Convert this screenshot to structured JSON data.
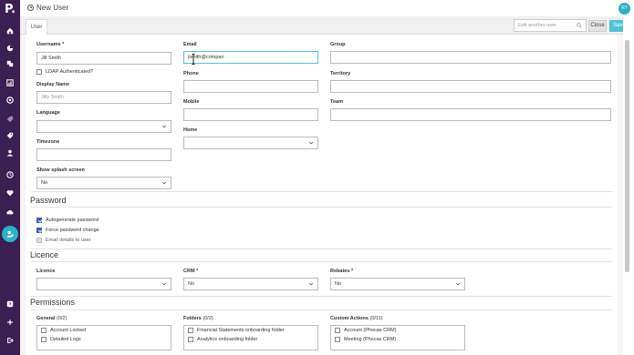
{
  "app": {
    "logo_letter": "P."
  },
  "header": {
    "title": "New User",
    "avatar_initials": "RT"
  },
  "colors": {
    "sidebar_bg": "#3a1f52",
    "accent": "#2bb3c7",
    "save_bg": "#4dc3d6",
    "checkbox_on": "#3a5fb5"
  },
  "sidebar": {
    "icons": [
      "home-icon",
      "chart-icon",
      "layers-icon",
      "report-icon",
      "analytics-icon",
      "tag-icon",
      "tag-alt-icon",
      "person-icon",
      "history-icon",
      "heart-icon",
      "cloud-icon",
      "user-settings-icon",
      "help-icon",
      "add-icon",
      "logout-icon"
    ],
    "active_icon": "user-settings-icon"
  },
  "tabs": [
    {
      "label": "User"
    }
  ],
  "toolbar": {
    "edit_another_placeholder": "Edit another user",
    "close_label": "Close",
    "save_label": "Save"
  },
  "form": {
    "username": {
      "label": "Username",
      "value": "Jill Smith"
    },
    "ldap": {
      "label": "LDAP Authenticated?",
      "checked": false
    },
    "display_name": {
      "label": "Display Name",
      "placeholder": "Jilly Smith"
    },
    "language": {
      "label": "Language",
      "value": ""
    },
    "timezone": {
      "label": "Timezone",
      "value": ""
    },
    "splash": {
      "label": "Show splash screen",
      "value": "No"
    },
    "email": {
      "label": "Email",
      "value": "jsmith@compan"
    },
    "phone": {
      "label": "Phone",
      "value": ""
    },
    "mobile": {
      "label": "Mobile",
      "value": ""
    },
    "home": {
      "label": "Home",
      "value": ""
    },
    "group": {
      "label": "Group",
      "value": ""
    },
    "territory": {
      "label": "Territory",
      "value": ""
    },
    "team": {
      "label": "Team",
      "value": ""
    }
  },
  "password": {
    "heading": "Password",
    "options": [
      {
        "label": "Autogenerate password",
        "checked": true
      },
      {
        "label": "Force password change",
        "checked": true
      },
      {
        "label": "Email details to user",
        "checked": false
      }
    ]
  },
  "licence": {
    "heading": "Licence",
    "licence_label": "Licence",
    "licence_value": "",
    "crm_label": "CRM",
    "crm_value": "No",
    "rebates_label": "Rebates",
    "rebates_value": "No"
  },
  "permissions": {
    "heading": "Permissions",
    "general": {
      "label": "General",
      "count": "(0/2)",
      "items": [
        "Account Locked",
        "Detailed Logs"
      ]
    },
    "folders": {
      "label": "Folders",
      "count": "(0/2)",
      "items": [
        "Financial Statements onboarding folder",
        "Analytics onboarding folder"
      ]
    },
    "custom": {
      "label": "Custom Actions",
      "count": "(0/11)",
      "items": [
        "Account (Phocas CRM)",
        "Meeting (Phocas CRM)"
      ]
    }
  }
}
